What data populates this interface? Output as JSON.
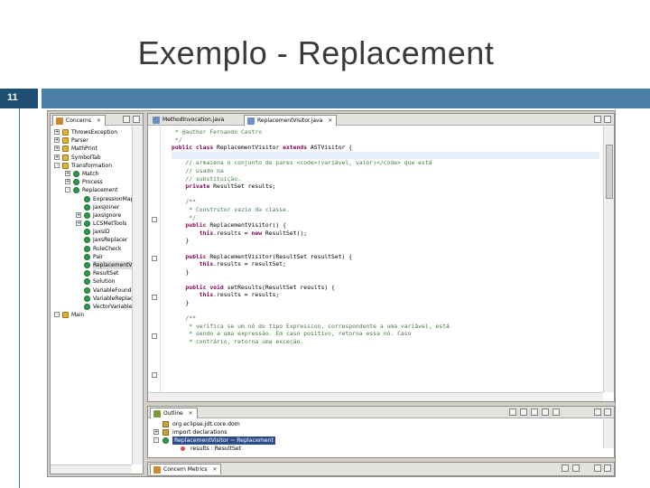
{
  "slide": {
    "title": "Exemplo - Replacement",
    "number": "11"
  },
  "colors": {
    "slide_bar": "#4a7fa6",
    "slide_num_bg": "#1e4f73",
    "keyword": "#7f0055",
    "comment": "#4a7a4a",
    "class_icon": "#2c9a4c"
  },
  "left_view": {
    "tab_label": "Concerns",
    "tree": [
      {
        "label": "ThrowsException",
        "level": 0,
        "expander": "+"
      },
      {
        "label": "Parser",
        "level": 0,
        "expander": "+"
      },
      {
        "label": "MathPrint",
        "level": 0,
        "expander": "+"
      },
      {
        "label": "SymbolTab",
        "level": 0,
        "expander": "+"
      },
      {
        "label": "Transformation",
        "level": 0,
        "expander": "-"
      },
      {
        "label": "Match",
        "level": 1,
        "expander": "+"
      },
      {
        "label": "Process",
        "level": 1,
        "expander": "+"
      },
      {
        "label": "Replacement",
        "level": 1,
        "expander": "-"
      },
      {
        "label": "ExpressionMap",
        "level": 2,
        "expander": ""
      },
      {
        "label": "JaxsJoiner",
        "level": 2,
        "expander": ""
      },
      {
        "label": "JaxsIgnore",
        "level": 2,
        "expander": "+"
      },
      {
        "label": "LCSMetTools",
        "level": 2,
        "expander": "+"
      },
      {
        "label": "JaxsID",
        "level": 2,
        "expander": ""
      },
      {
        "label": "JaxsReplacer",
        "level": 2,
        "expander": ""
      },
      {
        "label": "RuleCheck",
        "level": 2,
        "expander": ""
      },
      {
        "label": "Pair",
        "level": 2,
        "expander": ""
      },
      {
        "label": "ReplacementVisitor",
        "level": 2,
        "expander": "",
        "selected": true
      },
      {
        "label": "ResultSet",
        "level": 2,
        "expander": ""
      },
      {
        "label": "Solution",
        "level": 2,
        "expander": ""
      },
      {
        "label": "VariableFound",
        "level": 2,
        "expander": ""
      },
      {
        "label": "VariableReplace",
        "level": 2,
        "expander": ""
      },
      {
        "label": "VectorVariables",
        "level": 2,
        "expander": ""
      },
      {
        "label": "Main",
        "level": 0,
        "expander": "-"
      }
    ]
  },
  "editor": {
    "tabs": [
      {
        "label": "MethodInvocation.java",
        "active": false
      },
      {
        "label": "ReplacementVisitor.java",
        "active": true
      }
    ],
    "lines": [
      [
        {
          "t": " * ",
          "c": "cmt"
        },
        {
          "t": "@author Fernando Castro",
          "c": "cmt"
        }
      ],
      [
        {
          "t": " */",
          "c": "cmt"
        }
      ],
      [
        {
          "t": "public class ",
          "c": "kw"
        },
        {
          "t": "ReplacementVisitor ",
          "c": ""
        },
        {
          "t": "extends ",
          "c": "kw"
        },
        {
          "t": "ASTVisitor {",
          "c": ""
        }
      ],
      [
        {
          "t": "",
          "c": ""
        }
      ],
      [
        {
          "t": "    // armazena o conjunto de pares <code>(variável, valor)</code> que está",
          "c": "cmt"
        }
      ],
      [
        {
          "t": "    // usado na",
          "c": "cmt"
        }
      ],
      [
        {
          "t": "    // substituição.",
          "c": "cmt"
        }
      ],
      [
        {
          "t": "    private ",
          "c": "kw"
        },
        {
          "t": "ResultSet results;",
          "c": ""
        }
      ],
      [
        {
          "t": "",
          "c": ""
        }
      ],
      [
        {
          "t": "    /**",
          "c": "cmt"
        }
      ],
      [
        {
          "t": "     * Construtor vazio da classe.",
          "c": "cmt"
        }
      ],
      [
        {
          "t": "     */",
          "c": "cmt"
        }
      ],
      [
        {
          "t": "    public ",
          "c": "kw"
        },
        {
          "t": "ReplacementVisitor() {",
          "c": ""
        }
      ],
      [
        {
          "t": "        this",
          "c": "kw"
        },
        {
          "t": ".results = ",
          "c": ""
        },
        {
          "t": "new ",
          "c": "kw"
        },
        {
          "t": "ResultSet();",
          "c": ""
        }
      ],
      [
        {
          "t": "    }",
          "c": ""
        }
      ],
      [
        {
          "t": "",
          "c": ""
        }
      ],
      [
        {
          "t": "    public ",
          "c": "kw"
        },
        {
          "t": "ReplacementVisitor(ResultSet resultSet) {",
          "c": ""
        }
      ],
      [
        {
          "t": "        this",
          "c": "kw"
        },
        {
          "t": ".results = resultSet;",
          "c": ""
        }
      ],
      [
        {
          "t": "    }",
          "c": ""
        }
      ],
      [
        {
          "t": "",
          "c": ""
        }
      ],
      [
        {
          "t": "    public void ",
          "c": "kw"
        },
        {
          "t": "setResults(ResultSet results) {",
          "c": ""
        }
      ],
      [
        {
          "t": "        this",
          "c": "kw"
        },
        {
          "t": ".results = results;",
          "c": ""
        }
      ],
      [
        {
          "t": "    }",
          "c": ""
        }
      ],
      [
        {
          "t": "",
          "c": ""
        }
      ],
      [
        {
          "t": "    /**",
          "c": "cmt"
        }
      ],
      [
        {
          "t": "     * verifica se um nó do tipo Expression, correspondente a uma variável, está",
          "c": "cmt"
        }
      ],
      [
        {
          "t": "     * sendo a uma expressão. Em caso positivo, retorna essa nó. Caso",
          "c": "cmt"
        }
      ],
      [
        {
          "t": "     * contrário, retorna uma exceção.",
          "c": "cmt"
        }
      ]
    ]
  },
  "outline": {
    "tab_label": "Outline",
    "rows": [
      {
        "label": "org.eclipse.jdt.core.dom",
        "expander": "",
        "icon": "import"
      },
      {
        "label": "import declarations",
        "expander": "+",
        "icon": "import"
      },
      {
        "label": "ReplacementVisitor ~ Replacement",
        "expander": "-",
        "icon": "class",
        "selected": true
      },
      {
        "label": "results : ResultSet",
        "expander": "",
        "icon": "field"
      }
    ]
  },
  "bottom_view": {
    "tab_label": "Concern Metrics"
  }
}
